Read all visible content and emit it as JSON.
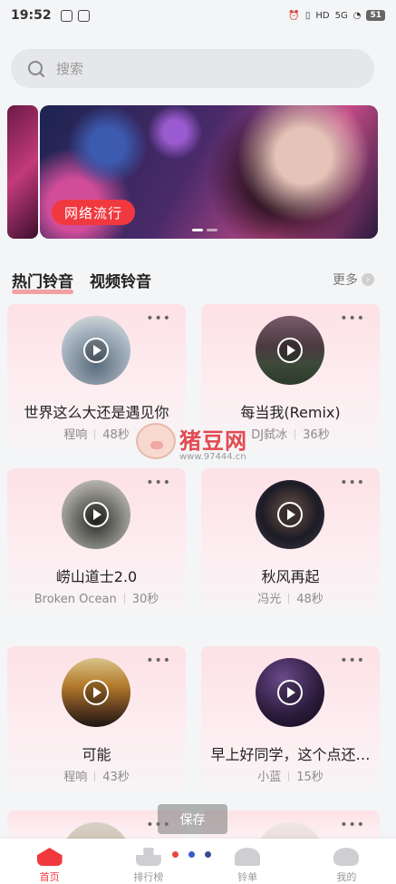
{
  "status_bar": {
    "time": "19:52",
    "network": "5G",
    "hd": "HD",
    "battery": "51"
  },
  "search": {
    "placeholder": "搜索"
  },
  "banner": {
    "tag": "网络流行"
  },
  "tabs": [
    {
      "label": "热门铃音",
      "active": true
    },
    {
      "label": "视频铃音",
      "active": false
    }
  ],
  "more_label": "更多",
  "cards": [
    {
      "title": "世界这么大还是遇见你",
      "artist": "程响",
      "duration": "48秒"
    },
    {
      "title": "每当我(Remix)",
      "artist": "DJ弑冰",
      "duration": "36秒"
    },
    {
      "title": "崂山道士2.0",
      "artist": "Broken Ocean",
      "duration": "30秒"
    },
    {
      "title": "秋风再起",
      "artist": "冯光",
      "duration": "48秒"
    },
    {
      "title": "可能",
      "artist": "程响",
      "duration": "43秒"
    },
    {
      "title": "早上好同学，这个点还…",
      "artist": "小蓝",
      "duration": "15秒"
    }
  ],
  "card_menu": "•••",
  "watermark": {
    "text": "猪豆网",
    "url": "www.97444.cn"
  },
  "toast": {
    "save": "保存"
  },
  "nav": [
    {
      "label": "首页",
      "active": true,
      "icon": "home-icon"
    },
    {
      "label": "排行榜",
      "active": false,
      "icon": "ranking-icon"
    },
    {
      "label": "铃单",
      "active": false,
      "icon": "bell-icon"
    },
    {
      "label": "我的",
      "active": false,
      "icon": "user-icon"
    }
  ],
  "colors": {
    "accent": "#f0393f",
    "page_dots": [
      "#e8453e",
      "#3a5bd0",
      "#3a4a8c"
    ]
  }
}
